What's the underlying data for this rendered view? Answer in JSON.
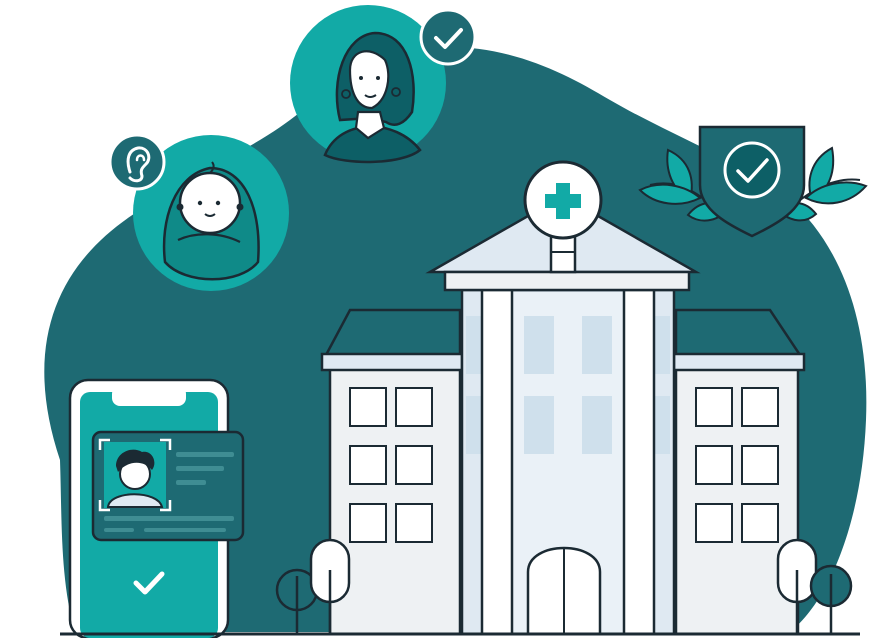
{
  "colors": {
    "blob": "#1e6a73",
    "teal": "#12aaa6",
    "tealDark": "#0f8a88",
    "tealDeep": "#0d5f66",
    "outline": "#1b2a33",
    "building": "#eef1f3",
    "columns": "#dfe9f2",
    "windowBlue": "#cfe0ec",
    "white": "#ffffff"
  },
  "icons": {
    "check_badge": "check-icon",
    "hearing": "ear-icon",
    "medical_cross": "plus-icon",
    "shield": "shield-check-icon"
  }
}
